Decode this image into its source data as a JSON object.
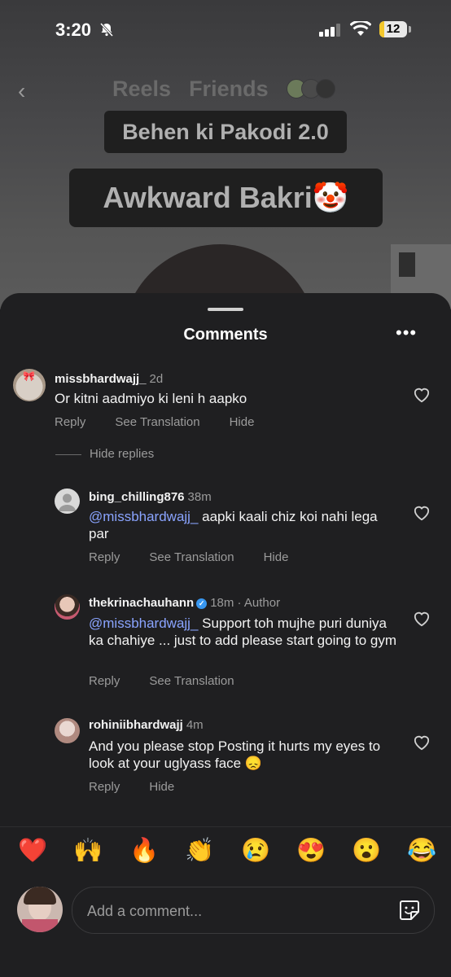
{
  "status_bar": {
    "time": "3:20",
    "battery": "12"
  },
  "header": {
    "tabs": [
      "Reels",
      "Friends"
    ]
  },
  "reel": {
    "caption1": "Behen ki Pakodi 2.0",
    "caption2": "Awkward Bakri🤡"
  },
  "sheet": {
    "title": "Comments",
    "more": "•••"
  },
  "comments": [
    {
      "username": "missbhardwajj_",
      "time": "2d",
      "text": "Or kitni aadmiyo ki leni h aapko",
      "actions": [
        "Reply",
        "See Translation",
        "Hide"
      ]
    }
  ],
  "hide_replies": "Hide replies",
  "replies": [
    {
      "username": "bing_chilling876",
      "time": "38m",
      "mention": "@missbhardwajj_",
      "text": " aapki kaali chiz koi nahi lega par",
      "actions": [
        "Reply",
        "See Translation",
        "Hide"
      ]
    },
    {
      "username": "thekrinachauhann",
      "time": "18m · Author",
      "mention": "@missbhardwajj_",
      "text": " Support toh mujhe puri duniya ka chahiye ... just to add please start going to gym",
      "actions": [
        "Reply",
        "See Translation"
      ]
    },
    {
      "username": "rohiniibhardwajj",
      "time": "4m",
      "text": "And you please stop Posting it hurts my eyes to look at your uglyass face 😞",
      "actions": [
        "Reply",
        "Hide"
      ]
    }
  ],
  "emojis": [
    "❤️",
    "🙌",
    "🔥",
    "👏",
    "😢",
    "😍",
    "😮",
    "😂"
  ],
  "input": {
    "placeholder": "Add a comment..."
  }
}
